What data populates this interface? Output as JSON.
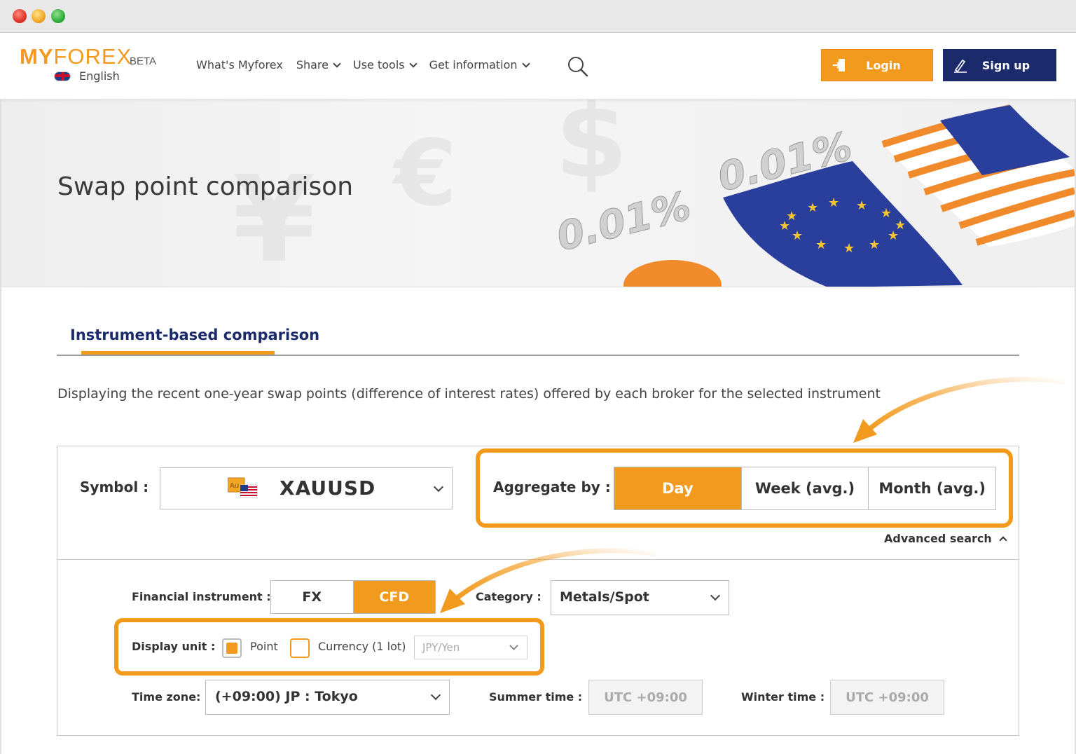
{
  "header": {
    "logo_my": "MY",
    "logo_forex": "FOREX",
    "logo_beta": "BETA",
    "language": "English",
    "nav": [
      {
        "label": "What's Myforex",
        "dropdown": false
      },
      {
        "label": "Share",
        "dropdown": true
      },
      {
        "label": "Use tools",
        "dropdown": true
      },
      {
        "label": "Get information",
        "dropdown": true
      }
    ],
    "login_label": "Login",
    "signup_label": "Sign up"
  },
  "hero": {
    "title": "Swap point comparison",
    "deco_text_1": "0.01%",
    "deco_text_2": "0.01%"
  },
  "tabs": {
    "active": "Instrument-based comparison"
  },
  "description": "Displaying the recent one-year swap points (difference of interest rates) offered by each broker for the selected instrument",
  "search": {
    "symbol_label": "Symbol :",
    "symbol_value": "XAUUSD",
    "symbol_flag_text": "Au",
    "aggregate_label": "Aggregate by :",
    "aggregate_options": [
      "Day",
      "Week (avg.)",
      "Month (avg.)"
    ],
    "aggregate_selected": "Day",
    "advanced_search": "Advanced search"
  },
  "advanced": {
    "instrument_label": "Financial instrument :",
    "instrument_options": [
      "FX",
      "CFD"
    ],
    "instrument_selected": "CFD",
    "category_label": "Category :",
    "category_value": "Metals/Spot",
    "display_unit_label": "Display unit :",
    "unit_point": "Point",
    "unit_currency": "Currency (1 lot)",
    "unit_currency_select": "JPY/Yen",
    "timezone_label": "Time zone:",
    "timezone_value": "(+09:00) JP : Tokyo",
    "summer_label": "Summer time :",
    "summer_value": "UTC +09:00",
    "winter_label": "Winter time :",
    "winter_value": "UTC +09:00"
  },
  "colors": {
    "accent": "#f29a1e",
    "navy": "#1b2a6b"
  }
}
